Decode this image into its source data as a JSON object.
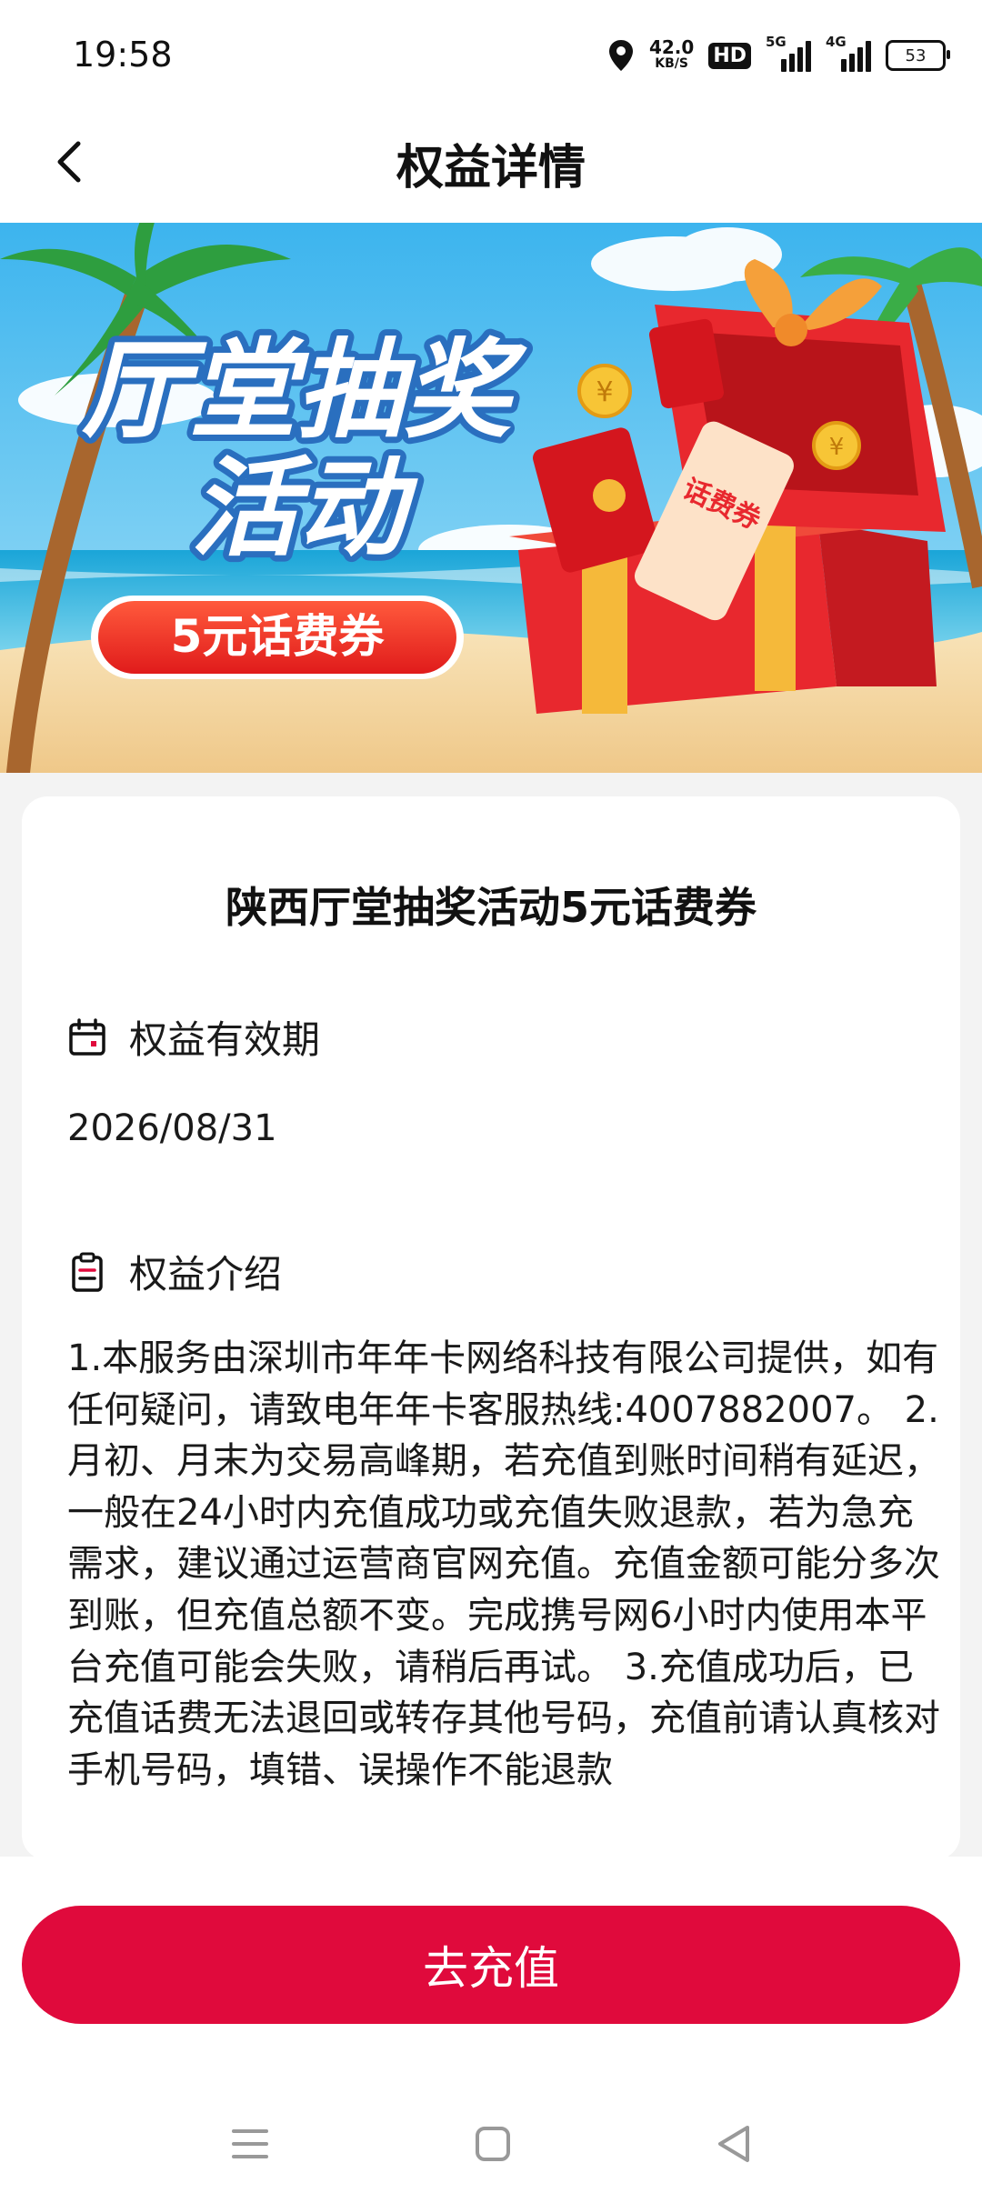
{
  "status_bar": {
    "time": "19:58",
    "net_speed_value": "42.0",
    "net_speed_unit": "KB/S",
    "hd_label": "HD",
    "sim1_tag": "5G",
    "sim2_tag": "4G",
    "battery": "53"
  },
  "header": {
    "title": "权益详情",
    "back_icon": "chevron-left-icon"
  },
  "banner": {
    "headline_line1": "厅堂抽奖",
    "headline_line2": "活动",
    "pill_label": "5元话费券",
    "ticket_text": "话费券",
    "colors": {
      "sky": "#5ec7f0",
      "sand": "#f4d9a6",
      "red": "#e8282e",
      "gold": "#f5b93a"
    }
  },
  "card": {
    "title": "陕西厅堂抽奖活动5元话费券",
    "validity": {
      "label": "权益有效期",
      "value": "2026/08/31",
      "icon": "calendar-icon"
    },
    "intro": {
      "label": "权益介绍",
      "icon": "clipboard-icon",
      "text": "1.本服务由深圳市年年卡网络科技有限公司提供，如有任何疑问，请致电年年卡客服热线:4007882007。 2.月初、月末为交易高峰期，若充值到账时间稍有延迟，一般在24小时内充值成功或充值失败退款，若为急充需求，建议通过运营商官网充值。充值金额可能分多次到账，但充值总额不变。完成携号网6小时内使用本平台充值可能会失败，请稍后再试。 3.充值成功后，已充值话费无法退回或转存其他号码，充值前请认真核对手机号码，填错、误操作不能退款"
    }
  },
  "cta": {
    "label": "去充值",
    "color": "#e00a3c"
  },
  "nav_bar": {
    "menu_icon": "menu-icon",
    "home_icon": "home-square-icon",
    "back_icon": "back-triangle-icon"
  }
}
